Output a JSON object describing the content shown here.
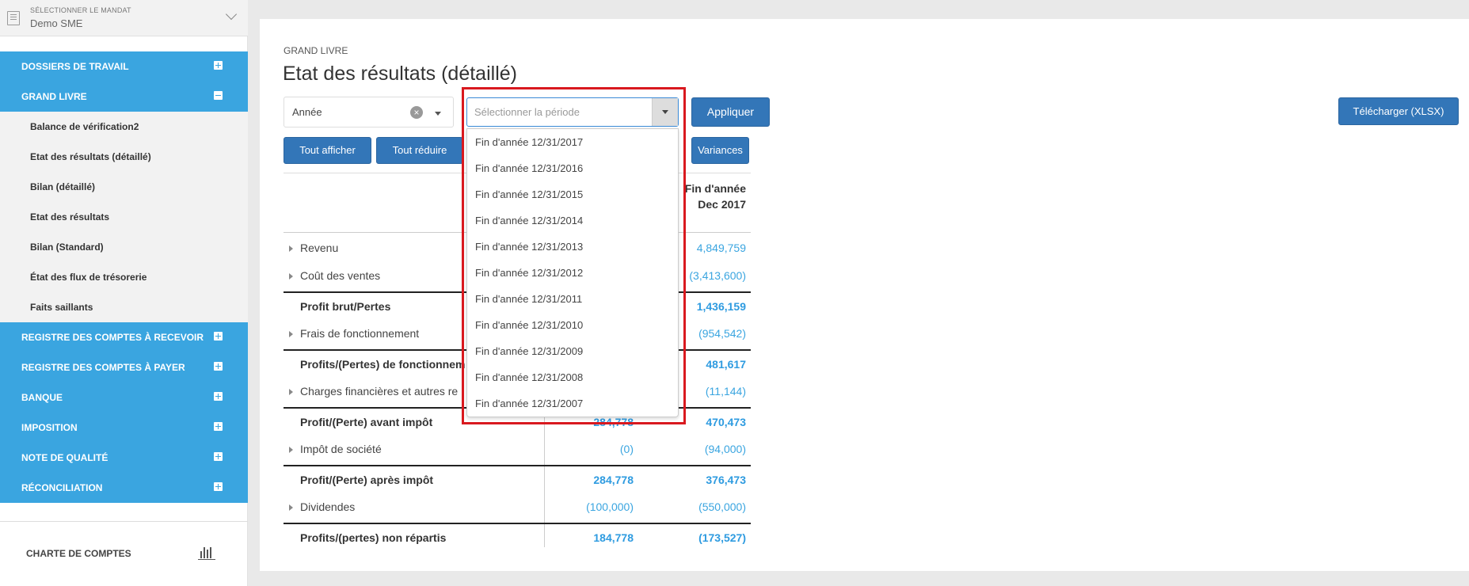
{
  "mandat": {
    "label": "SÉLECTIONNER LE MANDAT",
    "value": "Demo SME"
  },
  "nav": {
    "dossiers": "DOSSIERS DE TRAVAIL",
    "grand_livre": "GRAND LIVRE",
    "sub_items": [
      "Balance de vérification2",
      "Etat des résultats (détaillé)",
      "Bilan (détaillé)",
      "Etat des résultats",
      "Bilan (Standard)",
      "État des flux de trésorerie",
      "Faits saillants"
    ],
    "sections": [
      "REGISTRE DES COMPTES À RECEVOIR",
      "REGISTRE DES COMPTES À PAYER",
      "BANQUE",
      "IMPOSITION",
      "NOTE DE QUALITÉ",
      "RÉCONCILIATION"
    ],
    "charte": "CHARTE DE COMPTES"
  },
  "header": {
    "breadcrumb": "GRAND LIVRE",
    "title": "Etat des résultats (détaillé)"
  },
  "filters": {
    "annee_value": "Année",
    "period_placeholder": "Sélectionner la période",
    "apply": "Appliquer",
    "download": "Télécharger (XLSX)",
    "show_all": "Tout afficher",
    "collapse_all": "Tout réduire",
    "variances": "Variances"
  },
  "dropdown": {
    "options": [
      "Fin d'année 12/31/2017",
      "Fin d'année 12/31/2016",
      "Fin d'année 12/31/2015",
      "Fin d'année 12/31/2014",
      "Fin d'année 12/31/2013",
      "Fin d'année 12/31/2012",
      "Fin d'année 12/31/2011",
      "Fin d'année 12/31/2010",
      "Fin d'année 12/31/2009",
      "Fin d'année 12/31/2008",
      "Fin d'année 12/31/2007"
    ]
  },
  "report": {
    "column_header": [
      "Fin d'année",
      "Dec 2017"
    ],
    "rows": [
      {
        "label": "Revenu",
        "c1": "",
        "c2": "4,849,759",
        "total": false
      },
      {
        "label": "Coût des ventes",
        "c1": "",
        "c2": "(3,413,600)",
        "total": false
      },
      {
        "label": "Profit brut/Pertes",
        "c1": "",
        "c2": "1,436,159",
        "total": true
      },
      {
        "label": "Frais de fonctionnement",
        "c1": "",
        "c2": "(954,542)",
        "total": false
      },
      {
        "label": "Profits/(Pertes) de fonctionnem",
        "c1": "",
        "c2": "481,617",
        "total": true
      },
      {
        "label": "Charges financières et autres re",
        "c1": "",
        "c2": "(11,144)",
        "total": false
      },
      {
        "label": "Profit/(Perte) avant impôt",
        "c1": "284,778",
        "c2": "470,473",
        "total": true
      },
      {
        "label": "Impôt de société",
        "c1": "(0)",
        "c2": "(94,000)",
        "total": false
      },
      {
        "label": "Profit/(Perte) après impôt",
        "c1": "284,778",
        "c2": "376,473",
        "total": true
      },
      {
        "label": "Dividendes",
        "c1": "(100,000)",
        "c2": "(550,000)",
        "total": false
      },
      {
        "label": "Profits/(pertes) non répartis",
        "c1": "184,778",
        "c2": "(173,527)",
        "total": true
      }
    ]
  }
}
